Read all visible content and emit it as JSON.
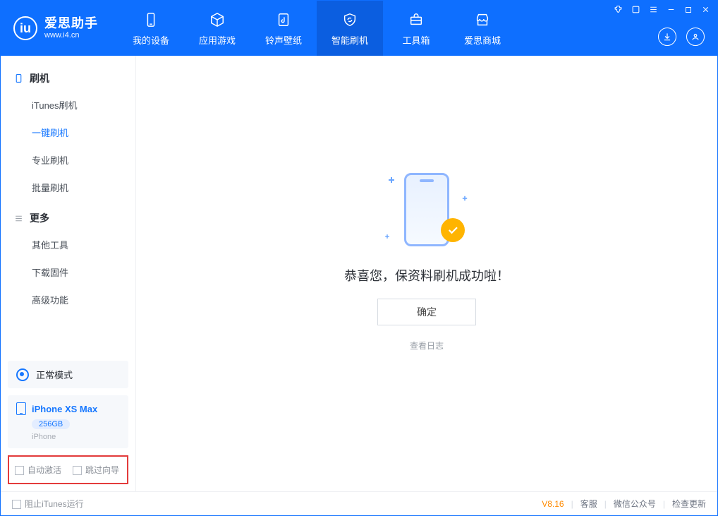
{
  "app": {
    "name_cn": "爱思助手",
    "name_en": "www.i4.cn"
  },
  "nav": {
    "items": [
      {
        "label": "我的设备"
      },
      {
        "label": "应用游戏"
      },
      {
        "label": "铃声壁纸"
      },
      {
        "label": "智能刷机"
      },
      {
        "label": "工具箱"
      },
      {
        "label": "爱思商城"
      }
    ]
  },
  "sidebar": {
    "section_flash": "刷机",
    "items_flash": [
      {
        "label": "iTunes刷机"
      },
      {
        "label": "一键刷机"
      },
      {
        "label": "专业刷机"
      },
      {
        "label": "批量刷机"
      }
    ],
    "section_more": "更多",
    "items_more": [
      {
        "label": "其他工具"
      },
      {
        "label": "下载固件"
      },
      {
        "label": "高级功能"
      }
    ]
  },
  "mode": {
    "label": "正常模式"
  },
  "device": {
    "name": "iPhone XS Max",
    "capacity": "256GB",
    "type": "iPhone"
  },
  "options": {
    "auto_activate": "自动激活",
    "skip_guide": "跳过向导"
  },
  "result": {
    "message": "恭喜您，保资料刷机成功啦！",
    "ok": "确定",
    "view_log": "查看日志"
  },
  "footer": {
    "block_itunes": "阻止iTunes运行",
    "version": "V8.16",
    "support": "客服",
    "wechat": "微信公众号",
    "check_update": "检查更新"
  }
}
